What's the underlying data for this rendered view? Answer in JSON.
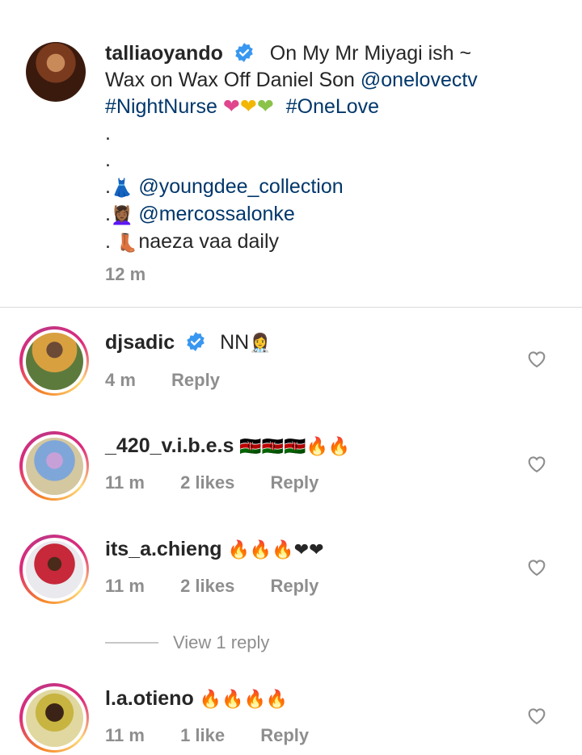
{
  "post": {
    "username": "talliaoyando",
    "caption_lines": [
      "On My Mr Miyagi ish ~",
      "Wax on Wax Off Daniel Son",
      "@onelovectv",
      "#NightNurse",
      "#OneLove",
      ".",
      ".",
      ".",
      "@youngdee_collection",
      ".",
      "@mercossalonke",
      ".",
      "naeza vaa daily"
    ],
    "time": "12 m",
    "emojis": {
      "hearts": [
        "❤",
        "💛",
        "💚"
      ],
      "dress": "👗",
      "salon": "💆🏾‍♀️",
      "boots": "👢"
    }
  },
  "comments": [
    {
      "username": "djsadic",
      "text": "NN",
      "emoji": "👩‍⚕️",
      "time": "4 m",
      "likes": "",
      "reply": "Reply",
      "verified": true
    },
    {
      "username": "_420_v.i.b.e.s",
      "text": "",
      "emoji": "🇰🇪🇰🇪🇰🇪🔥🔥",
      "time": "11 m",
      "likes": "2 likes",
      "reply": "Reply",
      "verified": false
    },
    {
      "username": "its_a.chieng",
      "text": "",
      "emoji": "🔥🔥🔥❤❤",
      "time": "11 m",
      "likes": "2 likes",
      "reply": "Reply",
      "verified": false,
      "view_replies": "View 1 reply"
    },
    {
      "username": "l.a.otieno",
      "text": "",
      "emoji": "🔥🔥🔥🔥",
      "time": "11 m",
      "likes": "1 like",
      "reply": "Reply",
      "verified": false
    }
  ],
  "colors": {
    "link": "#00376b",
    "muted": "#8e8e8e",
    "verified": "#3897f0",
    "heart_pink": "#e0468e"
  }
}
